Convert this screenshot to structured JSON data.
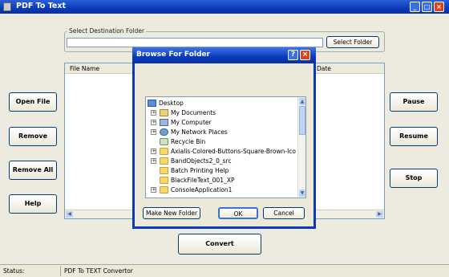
{
  "window": {
    "title": "PDF To Text",
    "min": "_",
    "max": "□",
    "close": "×"
  },
  "destination": {
    "legend": "Select Destination  Folder",
    "value": "",
    "select_button": "Select Folder"
  },
  "file_list": {
    "col_filename": "File Name",
    "col_date": "Date"
  },
  "buttons": {
    "open": "Open File",
    "remove": "Remove",
    "remove_all": "Remove All",
    "help": "Help",
    "pause": "Pause",
    "resume": "Resume",
    "stop": "Stop",
    "convert": "Convert"
  },
  "status": {
    "label": "Status:",
    "text": "PDF To TEXT Convertor"
  },
  "dialog": {
    "title": "Browse For Folder",
    "help": "?",
    "close": "×",
    "tree": [
      {
        "label": "Desktop",
        "icon": "desktop-icon",
        "expander": ""
      },
      {
        "label": "My Documents",
        "icon": "my-documents-icon",
        "expander": "+"
      },
      {
        "label": "My Computer",
        "icon": "my-computer-icon",
        "expander": "+"
      },
      {
        "label": "My Network Places",
        "icon": "network-places-icon",
        "expander": "+"
      },
      {
        "label": "Recycle Bin",
        "icon": "recycle-bin-icon",
        "expander": ""
      },
      {
        "label": "Axialis-Colored-Buttons-Square-Brown-Ico",
        "icon": "folder-icon",
        "expander": "+"
      },
      {
        "label": "BandObjects2_0_src",
        "icon": "folder-icon",
        "expander": "+"
      },
      {
        "label": "Batch Printing Help",
        "icon": "folder-icon",
        "expander": ""
      },
      {
        "label": "BlackFileText_001_XP",
        "icon": "folder-icon",
        "expander": ""
      },
      {
        "label": "ConsoleApplication1",
        "icon": "folder-icon",
        "expander": "+"
      }
    ],
    "new_folder": "Make New Folder",
    "ok": "OK",
    "cancel": "Cancel"
  }
}
